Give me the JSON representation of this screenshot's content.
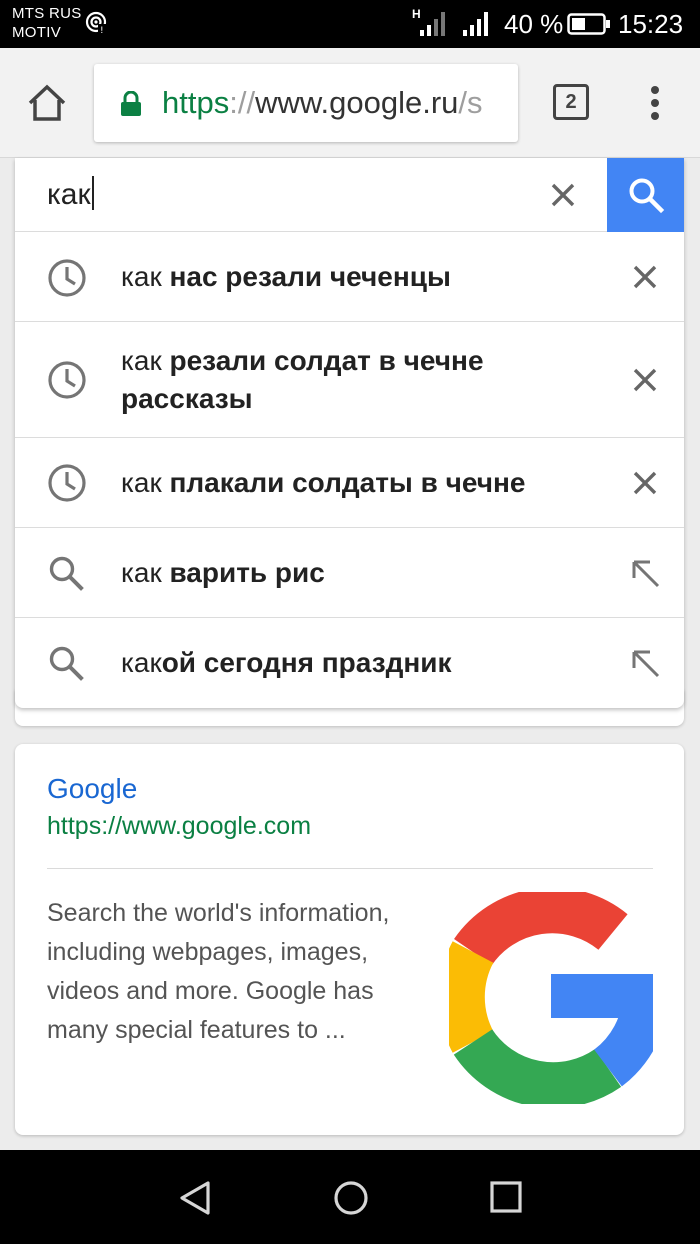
{
  "status_bar": {
    "carrier_line1": "MTS RUS",
    "carrier_line2": "MOTIV",
    "network_type": "H",
    "battery_percent": "40 %",
    "time": "15:23",
    "icons": [
      "hotspot-icon",
      "signal-icon",
      "signal-icon",
      "battery-icon"
    ]
  },
  "browser": {
    "url_scheme": "https",
    "url_separator": "://",
    "url_host": "www.google.ru",
    "url_rest": "/s",
    "tab_count": "2",
    "icons": [
      "home-icon",
      "lock-icon",
      "tabs-icon",
      "more-vert-icon"
    ]
  },
  "search": {
    "query": "как",
    "clear_icon": "close-icon",
    "search_icon": "search-icon",
    "suggestions": [
      {
        "prefix": "как",
        "completion": " нас резали чеченцы",
        "type": "history",
        "icon": "history-icon",
        "action": "remove-icon"
      },
      {
        "prefix": "как",
        "completion": " резали солдат в чечне рассказы",
        "type": "history",
        "icon": "history-icon",
        "action": "remove-icon"
      },
      {
        "prefix": "как",
        "completion": " плакали солдаты в чечне",
        "type": "history",
        "icon": "history-icon",
        "action": "remove-icon"
      },
      {
        "prefix": "как",
        "completion": " варить рис",
        "type": "suggestion",
        "icon": "search-icon",
        "action": "refine-arrow-icon"
      },
      {
        "prefix": "как",
        "completion": "ой сегодня праздник",
        "type": "suggestion",
        "icon": "search-icon",
        "action": "refine-arrow-icon"
      }
    ]
  },
  "result": {
    "title": "Google",
    "url": "https://www.google.com",
    "snippet": "Search the world's information, including webpages, images, videos and more. Google has many special features to ...",
    "image_icon": "google-g-logo"
  },
  "nav_bar": {
    "icons": [
      "back-icon",
      "home-circle-icon",
      "recents-icon"
    ]
  },
  "colors": {
    "accent_blue": "#4285f4",
    "link_blue": "#1967d2",
    "url_green": "#0b8043",
    "status_bar_bg": "#000000",
    "google_red": "#ea4335",
    "google_yellow": "#fbbc05",
    "google_green": "#34a853",
    "google_blue": "#4285f4"
  }
}
